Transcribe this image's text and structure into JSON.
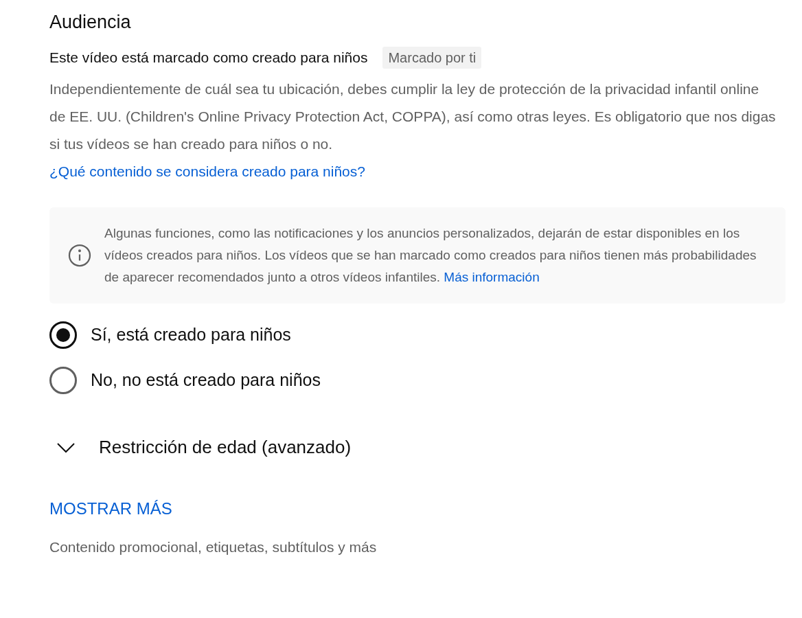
{
  "section": {
    "title": "Audiencia"
  },
  "made_for_kids": {
    "label": "Este vídeo está marcado como creado para niños",
    "tag": "Marcado por ti",
    "description": "Independientemente de cuál sea tu ubicación, debes cumplir la ley de protección de la privacidad infantil online de EE. UU. (Children's Online Privacy Protection Act, COPPA), así como otras leyes. Es obligatorio que nos digas si tus vídeos se han creado para niños o no.",
    "link": "¿Qué contenido se considera creado para niños?"
  },
  "notice": {
    "text": "Algunas funciones, como las notificaciones y los anuncios personalizados, dejarán de estar disponibles en los vídeos creados para niños. Los vídeos que se han marcado como creados para niños tienen más probabilidades de aparecer recomendados junto a otros vídeos infantiles.",
    "link": "Más información"
  },
  "options": [
    {
      "label": "Sí, está creado para niños",
      "selected": true
    },
    {
      "label": "No, no está creado para niños",
      "selected": false
    }
  ],
  "age_restriction": {
    "label": "Restricción de edad (avanzado)",
    "expanded": false
  },
  "show_more": {
    "label": "MOSTRAR MÁS",
    "hint": "Contenido promocional, etiquetas, subtítulos y más"
  }
}
